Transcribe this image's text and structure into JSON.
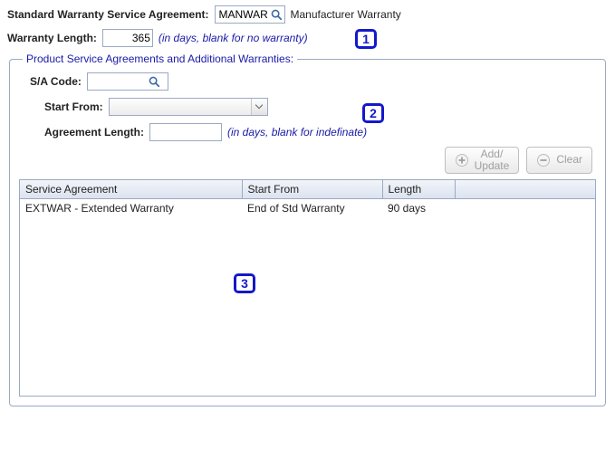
{
  "top": {
    "sa_label": "Standard Warranty Service Agreement:",
    "sa_value": "MANWAR",
    "sa_description": "Manufacturer Warranty",
    "warranty_len_label": "Warranty Length:",
    "warranty_len_value": "365",
    "warranty_len_hint": "(in days, blank for no warranty)"
  },
  "group": {
    "legend": "Product Service Agreements and Additional Warranties:",
    "sa_code_label": "S/A Code:",
    "sa_code_value": "",
    "start_from_label": "Start From:",
    "start_from_value": "",
    "agreement_len_label": "Agreement Length:",
    "agreement_len_value": "",
    "agreement_len_hint": "(in days, blank for indefinate)",
    "buttons": {
      "add_update": "Add/\nUpdate",
      "clear": "Clear"
    }
  },
  "table": {
    "columns": [
      "Service Agreement",
      "Start From",
      "Length"
    ],
    "rows": [
      {
        "sa": "EXTWAR - Extended Warranty",
        "start_from": "End of Std Warranty",
        "length": "90 days"
      }
    ]
  },
  "callouts": {
    "c1": "1",
    "c2": "2",
    "c3": "3"
  }
}
